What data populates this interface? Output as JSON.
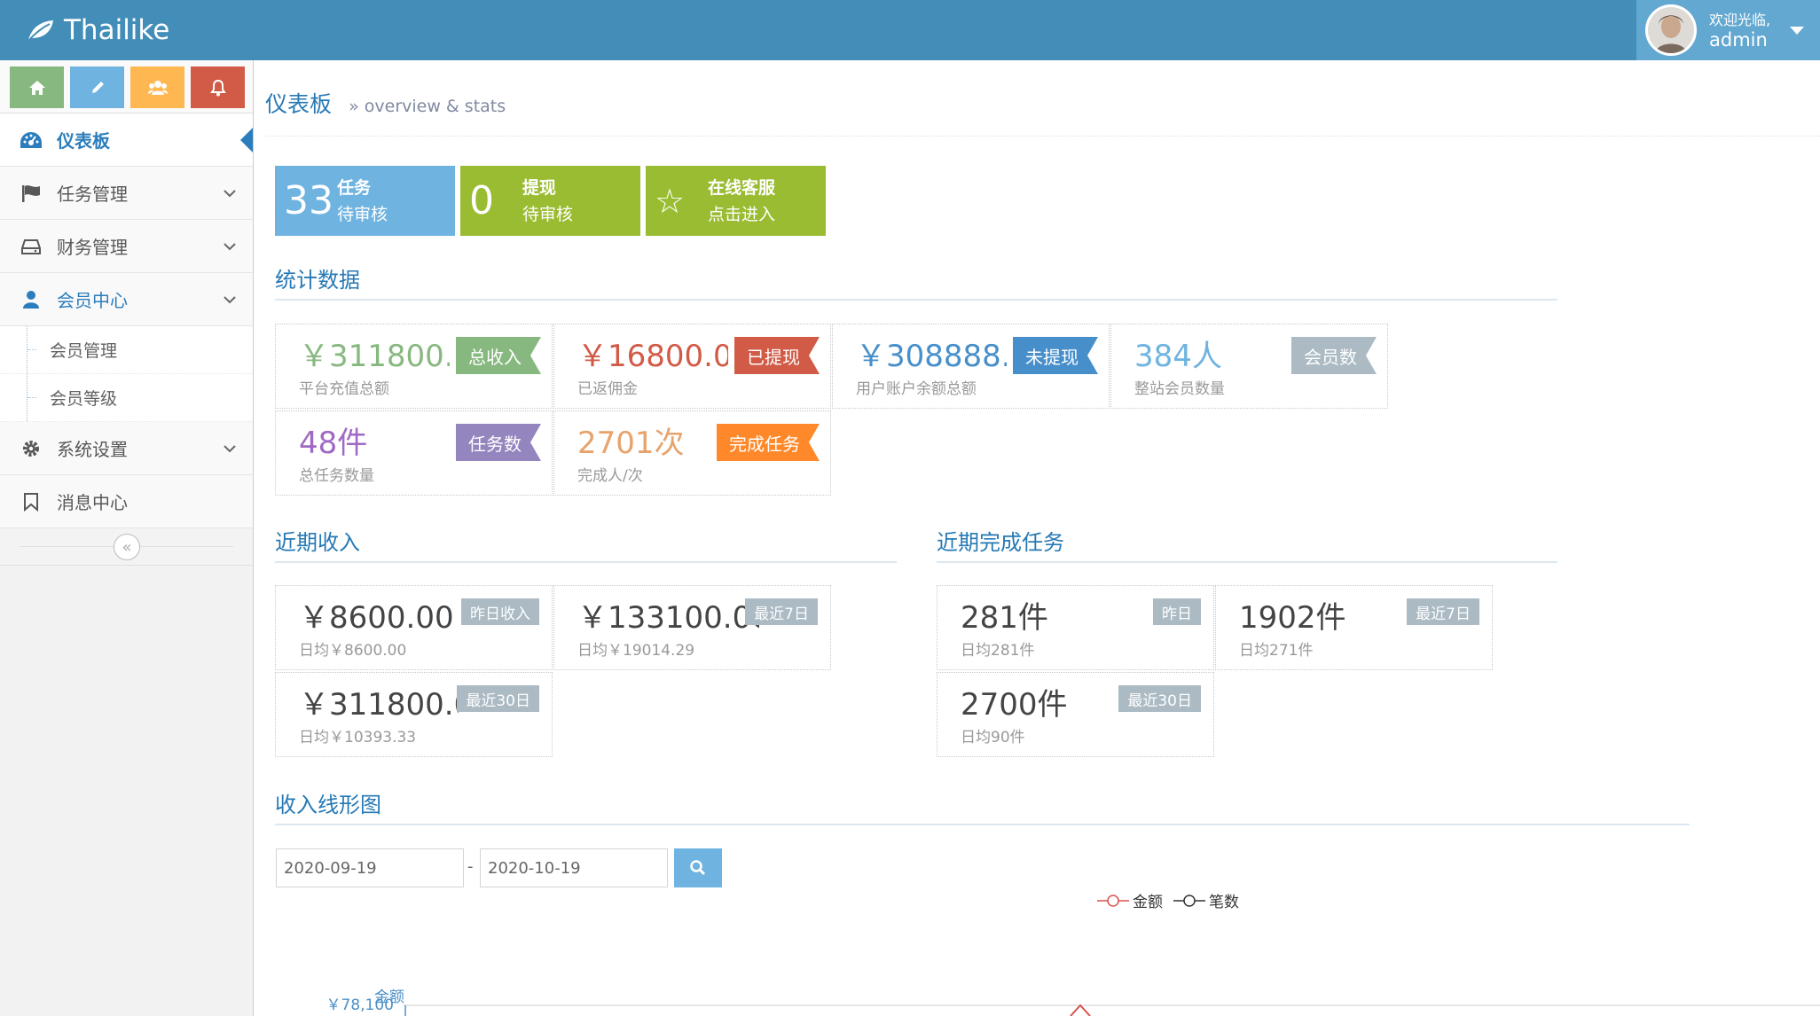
{
  "header": {
    "brand": "Thailike",
    "welcome": "欢迎光临,",
    "username": "admin"
  },
  "sidebar": {
    "shortcuts": [
      {
        "icon": "home-icon",
        "color": "#87b87f"
      },
      {
        "icon": "pencil-icon",
        "color": "#6fb3e0"
      },
      {
        "icon": "users-icon",
        "color": "#ffb752"
      },
      {
        "icon": "bell-icon",
        "color": "#d15b47"
      }
    ],
    "items": [
      {
        "label": "仪表板",
        "icon": "dashboard-icon",
        "active": true
      },
      {
        "label": "任务管理",
        "icon": "flag-icon"
      },
      {
        "label": "财务管理",
        "icon": "hdd-icon"
      },
      {
        "label": "会员中心",
        "icon": "user-icon"
      },
      {
        "label": "会员管理",
        "sub": true
      },
      {
        "label": "会员等级",
        "sub": true
      },
      {
        "label": "系统设置",
        "icon": "gear-icon"
      },
      {
        "label": "消息中心",
        "icon": "bookmark-icon"
      }
    ]
  },
  "page": {
    "title": "仪表板",
    "subtitle": "» overview & stats"
  },
  "infoboxes": [
    {
      "num": "33",
      "t1": "任务",
      "t2": "待审核",
      "color": "#6fb3e0"
    },
    {
      "num": "0",
      "t1": "提现",
      "t2": "待审核",
      "color": "#9abc32"
    },
    {
      "num": "☆",
      "t1": "在线客服",
      "t2": "点击进入",
      "color": "#9abc32"
    }
  ],
  "stats_title": "统计数据",
  "stats": [
    {
      "value": "￥311800.00",
      "desc": "平台充值总额",
      "badge": "总收入",
      "value_color": "#87b87f",
      "badge_color": "#87b87f"
    },
    {
      "value": "￥16800.00",
      "desc": "已返佣金",
      "badge": "已提现",
      "value_color": "#d15b47",
      "badge_color": "#d15b47"
    },
    {
      "value": "￥308888.33",
      "desc": "用户账户余额总额",
      "badge": "未提现",
      "value_color": "#478fca",
      "badge_color": "#478fca"
    },
    {
      "value": "384人",
      "desc": "整站会员数量",
      "badge": "会员数",
      "value_color": "#6fb3e0",
      "badge_color": "#abbac3"
    },
    {
      "value": "48件",
      "desc": "总任务数量",
      "badge": "任务数",
      "value_color": "#a069c3",
      "badge_color": "#9585bf"
    },
    {
      "value": "2701次",
      "desc": "完成人/次",
      "badge": "完成任务",
      "value_color": "#e7a36c",
      "badge_color": "#ff892a"
    }
  ],
  "income_title": "近期收入",
  "income": [
    {
      "value": "￥8600.00",
      "desc": "日均￥8600.00",
      "label": "昨日收入"
    },
    {
      "value": "￥133100.00",
      "desc": "日均￥19014.29",
      "label": "最近7日"
    },
    {
      "value": "￥311800.00",
      "desc": "日均￥10393.33",
      "label": "最近30日"
    }
  ],
  "tasks_title": "近期完成任务",
  "tasks": [
    {
      "value": "281件",
      "desc": "日均281件",
      "label": "昨日"
    },
    {
      "value": "1902件",
      "desc": "日均271件",
      "label": "最近7日"
    },
    {
      "value": "2700件",
      "desc": "日均90件",
      "label": "最近30日"
    }
  ],
  "chart_section": {
    "title": "收入线形图",
    "date_from": "2020-09-19",
    "date_sep": "-",
    "date_to": "2020-10-19"
  },
  "chart_data": {
    "type": "line",
    "series": [
      {
        "name": "金额",
        "color": "#d9534f"
      },
      {
        "name": "笔数",
        "color": "#333333"
      }
    ],
    "ylabel": "金额",
    "y_ticks": [
      "￥78,100"
    ]
  }
}
